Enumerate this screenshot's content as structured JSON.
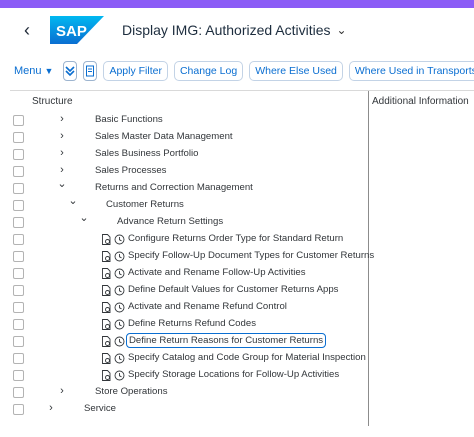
{
  "shell": {
    "back_icon": "chevron-left-icon",
    "logo_text": "SAP",
    "title": "Display IMG: Authorized Activities",
    "title_chevron": "chevron-down-icon",
    "strip_color": "#8b5cf6"
  },
  "toolbar": {
    "menu_label": "Menu",
    "buttons": [
      "Apply Filter",
      "Change Log",
      "Where Else Used",
      "Where Used in Transports"
    ]
  },
  "table": {
    "col_structure": "Structure",
    "col_info": "Additional Information",
    "rows": [
      {
        "label": "Basic Functions",
        "expander": "›"
      },
      {
        "label": "Sales Master Data Management",
        "expander": "›"
      },
      {
        "label": "Sales Business Portfolio",
        "expander": "›"
      },
      {
        "label": "Sales Processes",
        "expander": "›"
      },
      {
        "label": "Returns and Correction Management",
        "expander": "⌄"
      },
      {
        "label": "Customer Returns",
        "expander": "⌄"
      },
      {
        "label": "Advance Return Settings",
        "expander": "⌄"
      },
      {
        "label": "Configure Returns Order Type for Standard Return"
      },
      {
        "label": "Specify Follow-Up Document Types for Customer Returns"
      },
      {
        "label": "Activate and Rename Follow-Up Activities"
      },
      {
        "label": "Define Default Values for Customer Returns Apps"
      },
      {
        "label": "Activate and Rename Refund Control"
      },
      {
        "label": "Define Returns Refund Codes"
      },
      {
        "label": "Define Return Reasons for Customer Returns",
        "focused": true
      },
      {
        "label": "Specify Catalog and Code Group for Material Inspection"
      },
      {
        "label": "Specify Storage Locations for Follow-Up Activities"
      },
      {
        "label": "Store Operations",
        "expander": "›"
      },
      {
        "label": "Service",
        "expander": "›"
      }
    ]
  }
}
